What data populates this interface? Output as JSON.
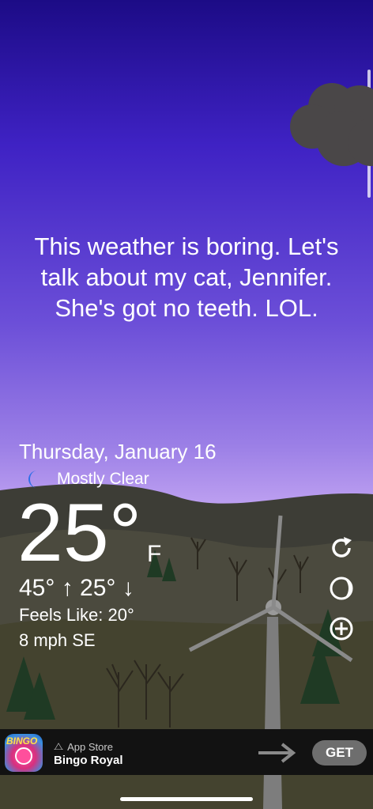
{
  "message": "This weather is boring. Let's talk about my cat, Jennifer. She's got no teeth. LOL.",
  "weather": {
    "date": "Thursday, January 16",
    "condition": "Mostly Clear",
    "condition_icon": "crescent-moon-icon",
    "temperature": "25°",
    "unit": "F",
    "hi_lo": "45° ↑ 25° ↓",
    "feels_like": "Feels Like: 20°",
    "wind": "8 mph SE"
  },
  "side_buttons": [
    {
      "name": "refresh-icon"
    },
    {
      "name": "moon-phase-icon"
    },
    {
      "name": "add-location-icon"
    }
  ],
  "ad": {
    "icon_label": "BINGO",
    "store": "App Store",
    "title": "Bingo Royal",
    "cta": "GET",
    "icon": "arrow-right-icon"
  },
  "colors": {
    "sky_top": "#1c0b86",
    "sky_bottom": "#bfa6f2",
    "ground": "#4a4a3f",
    "accent_moon": "#2f6fe8",
    "button_get": "#6e6e6e"
  }
}
